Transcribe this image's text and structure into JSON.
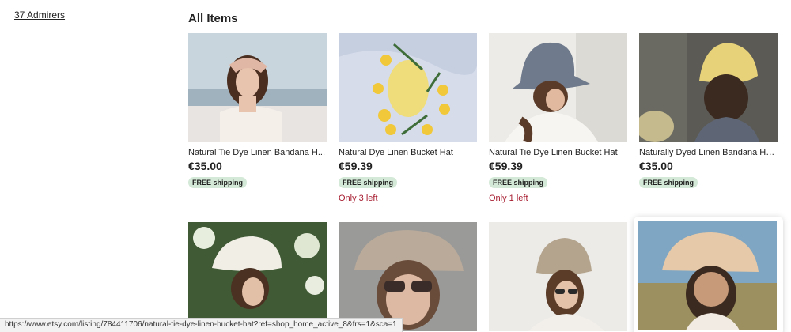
{
  "admirers": {
    "label": "37 Admirers"
  },
  "section": {
    "title": "All Items"
  },
  "items": [
    {
      "title": "Natural Tie Dye Linen Bandana H...",
      "price": "€35.00",
      "badge": "FREE shipping",
      "stock": ""
    },
    {
      "title": "Natural Dye Linen Bucket Hat",
      "price": "€59.39",
      "badge": "FREE shipping",
      "stock": "Only 3 left"
    },
    {
      "title": "Natural Tie Dye Linen Bucket Hat",
      "price": "€59.39",
      "badge": "FREE shipping",
      "stock": "Only 1 left"
    },
    {
      "title": "Naturally Dyed Linen Bandana He...",
      "price": "€35.00",
      "badge": "FREE shipping",
      "stock": ""
    }
  ],
  "status_url": "https://www.etsy.com/listing/784411706/natural-tie-dye-linen-bucket-hat?ref=shop_home_active_8&frs=1&sca=1",
  "colors": {
    "badge_bg": "#d4e9d7",
    "stock_text": "#a61a2e"
  }
}
